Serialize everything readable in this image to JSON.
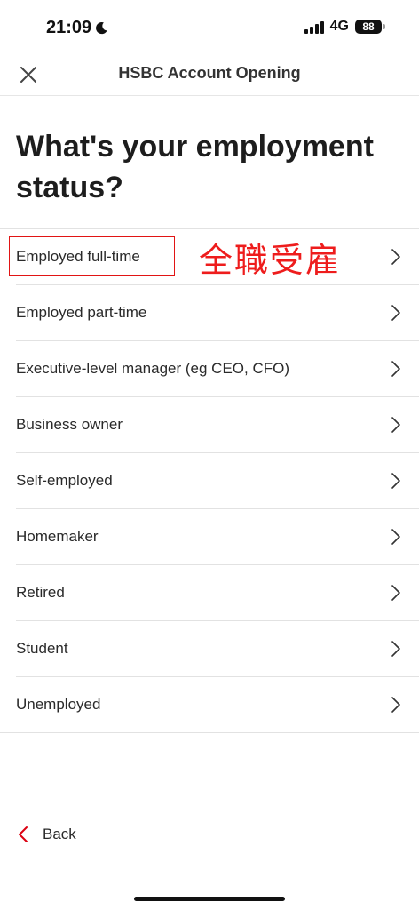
{
  "status_bar": {
    "time": "21:09",
    "network": "4G",
    "battery": "88",
    "icons": [
      "moon-icon",
      "signal-icon",
      "battery-icon"
    ]
  },
  "header": {
    "title": "HSBC Account Opening",
    "close_icon": "close-icon"
  },
  "page": {
    "title": "What's your employment status?"
  },
  "options": [
    {
      "label": "Employed full-time"
    },
    {
      "label": "Employed part-time"
    },
    {
      "label": "Executive-level manager (eg CEO, CFO)"
    },
    {
      "label": "Business owner"
    },
    {
      "label": "Self-employed"
    },
    {
      "label": "Homemaker"
    },
    {
      "label": "Retired"
    },
    {
      "label": "Student"
    },
    {
      "label": "Unemployed"
    }
  ],
  "annotation": {
    "text": "全職受雇",
    "color": "#ee1c1c"
  },
  "footer": {
    "back_label": "Back",
    "accent_color": "#db0011"
  }
}
